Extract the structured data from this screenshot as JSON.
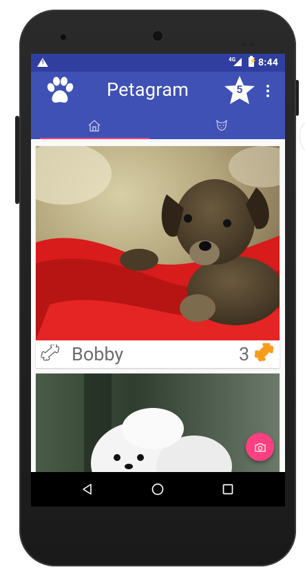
{
  "status_bar": {
    "network": "4G",
    "battery_glyph": "⚡",
    "warning_glyph": "!",
    "time": "8:44"
  },
  "app_bar": {
    "title": "Petagram",
    "favorites_count": "5",
    "logo_icon": "paw-icon",
    "favorites_icon": "star-icon",
    "menu_icon": "overflow-menu-icon"
  },
  "tabs": [
    {
      "icon": "home-icon",
      "selected": true
    },
    {
      "icon": "dog-face-icon",
      "selected": false
    }
  ],
  "pets": [
    {
      "name": "Bobby",
      "likes": "3",
      "photo": "brown puppy on red blanket"
    },
    {
      "name": "",
      "likes": "",
      "photo": "white pomeranian puppy"
    }
  ],
  "fab": {
    "icon": "camera-icon"
  },
  "nav_bar": {
    "buttons": [
      "back-icon",
      "home-circle-icon",
      "recents-icon"
    ]
  },
  "colors": {
    "primary": "#3f51b5",
    "primary_dark": "#303f9f",
    "accent": "#ff4081",
    "bone_like": "#f99b1c",
    "text_secondary": "#6d6d6d"
  }
}
